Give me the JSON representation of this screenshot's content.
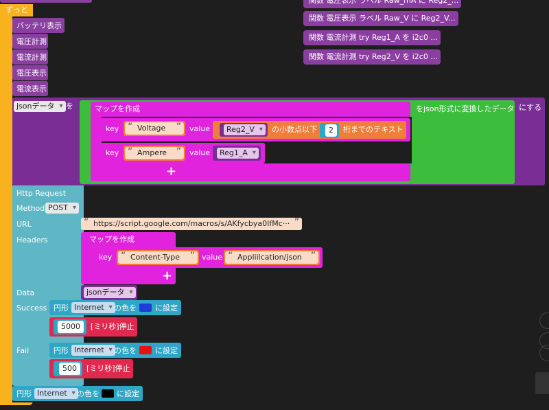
{
  "functions": [
    "関数 電圧表示 ラベル Raw_mA に Reg2_...",
    "関数 電圧表示 ラベル Raw_V に Reg2_V...",
    "関数 電流計測 try Reg1_A を i2c0 ...",
    "関数 電流計測 try Reg2_V を i2c0 ..."
  ],
  "loop": {
    "label": "ずっと"
  },
  "calls": [
    "バッテリ表示",
    "電圧計測",
    "電流計測",
    "電圧表示",
    "電流表示"
  ],
  "json_set": {
    "var": "jsonデータ",
    "suffix": "を",
    "map_label": "マップを作成",
    "convert": "をjson形式に変換したデータ",
    "tail": "にする",
    "key1": "key",
    "key1_str": "Voltage",
    "value1": "value",
    "reg2": "Reg2_V",
    "decimal_label": "の小数点以下",
    "decimal_val": "2",
    "decimal_tail": "桁までのテキスト",
    "key2": "key",
    "key2_str": "Ampere",
    "value2": "value",
    "reg1": "Reg1_A"
  },
  "http": {
    "title": "Http Request",
    "method_label": "Method",
    "method": "POST",
    "url_label": "URL",
    "url": "https://script.google.com/macros/s/AKfycbya0IfMc···",
    "headers_label": "Headers",
    "map_label": "マップを作成",
    "key": "key",
    "key_str": "Content-Type",
    "value": "value",
    "value_str": "Appliilcation/json",
    "data_label": "Data",
    "data_var": "jsonデータ",
    "success_label": "Success",
    "fail_label": "Fail"
  },
  "success": {
    "shape": "円形",
    "target": "Internet",
    "color_label": "の色を",
    "color": "#1f3bd8",
    "set": "に設定",
    "wait": "5000",
    "wait_label": "[ミリ秒]停止"
  },
  "fail": {
    "shape": "円形",
    "target": "Internet",
    "color_label": "の色を",
    "color": "#e81010",
    "set": "に設定",
    "wait": "500",
    "wait_label": "[ミリ秒]停止"
  },
  "final": {
    "shape": "円形",
    "target": "Internet",
    "color_label": "の色を",
    "color": "#000000",
    "set": "に設定"
  }
}
